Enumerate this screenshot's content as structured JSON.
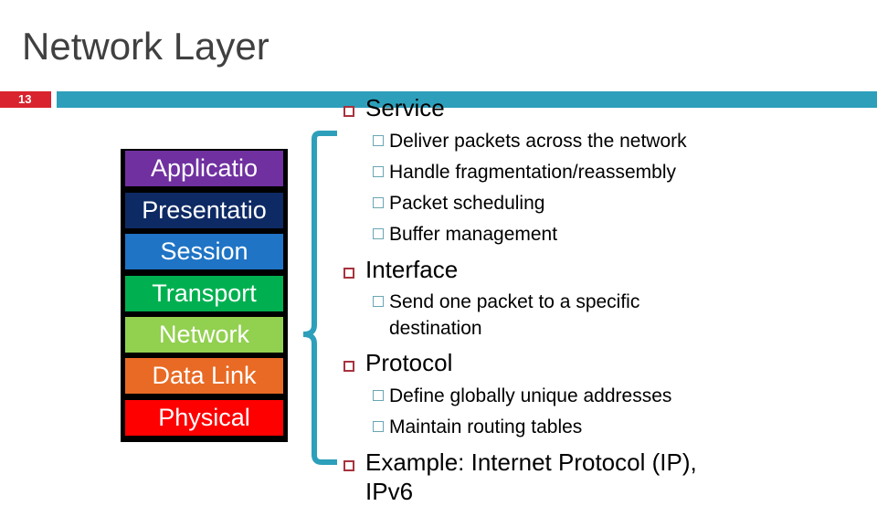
{
  "slide": {
    "title": "Network Layer",
    "page_number": "13",
    "colors": {
      "title_text": "#404040",
      "page_badge": "#d9232e",
      "header_bar": "#2d9fbb",
      "level1_bullet": "#a8323e",
      "level2_bullet": "#6aa6b4",
      "bracket": "#2d9fbb"
    }
  },
  "osi_stack": {
    "layers": [
      {
        "label": "Applicatio",
        "color": "#7030a0"
      },
      {
        "label": "Presentatio",
        "color": "#0e2a64"
      },
      {
        "label": "Session",
        "color": "#1f74c5"
      },
      {
        "label": "Transport",
        "color": "#00b050"
      },
      {
        "label": "Network",
        "color": "#92d050"
      },
      {
        "label": "Data Link",
        "color": "#e86a24"
      },
      {
        "label": "Physical",
        "color": "#fe0000"
      }
    ],
    "highlighted_layer": "Network"
  },
  "content": {
    "sections": [
      {
        "heading": "Service",
        "items": [
          "Deliver packets across the network",
          "Handle fragmentation/reassembly",
          "Packet scheduling",
          "Buffer management"
        ]
      },
      {
        "heading": "Interface",
        "items": [
          "Send one packet to a specific destination"
        ]
      },
      {
        "heading": "Protocol",
        "items": [
          "Define globally unique addresses",
          "Maintain routing tables"
        ]
      },
      {
        "heading": "Example: Internet Protocol (IP), IPv6",
        "items": []
      }
    ]
  }
}
